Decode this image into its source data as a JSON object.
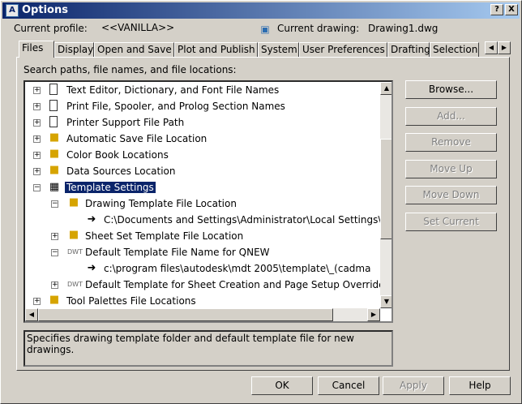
{
  "window": {
    "title": "Options",
    "help_btn": "?",
    "close_btn": "X"
  },
  "profile": {
    "label": "Current profile:",
    "value": "<<VANILLA>>"
  },
  "drawing": {
    "label": "Current drawing:",
    "value": "Drawing1.dwg"
  },
  "tabs": [
    "Files",
    "Display",
    "Open and Save",
    "Plot and Publish",
    "System",
    "User Preferences",
    "Drafting",
    "Selection"
  ],
  "tree": {
    "heading": "Search paths, file names, and file locations:",
    "items": [
      "Text Editor, Dictionary, and Font File Names",
      "Print File, Spooler, and Prolog Section Names",
      "Printer Support File Path",
      "Automatic Save File Location",
      "Color Book Locations",
      "Data Sources Location",
      "Template Settings",
      "Drawing Template File Location",
      "C:\\Documents and Settings\\Administrator\\Local Settings\\",
      "Sheet Set Template File Location",
      "Default Template File Name for QNEW",
      "c:\\program files\\autodesk\\mdt 2005\\template\\_(cadma",
      "Default Template for Sheet Creation and Page Setup Overrides",
      "Tool Palettes File Locations"
    ]
  },
  "side_buttons": {
    "browse": "Browse...",
    "add": "Add...",
    "remove": "Remove",
    "move_up": "Move Up",
    "move_down": "Move Down",
    "set_current": "Set Current"
  },
  "description": "Specifies drawing template folder and default template file for new drawings.",
  "footer": {
    "ok": "OK",
    "cancel": "Cancel",
    "apply": "Apply",
    "help": "Help"
  }
}
